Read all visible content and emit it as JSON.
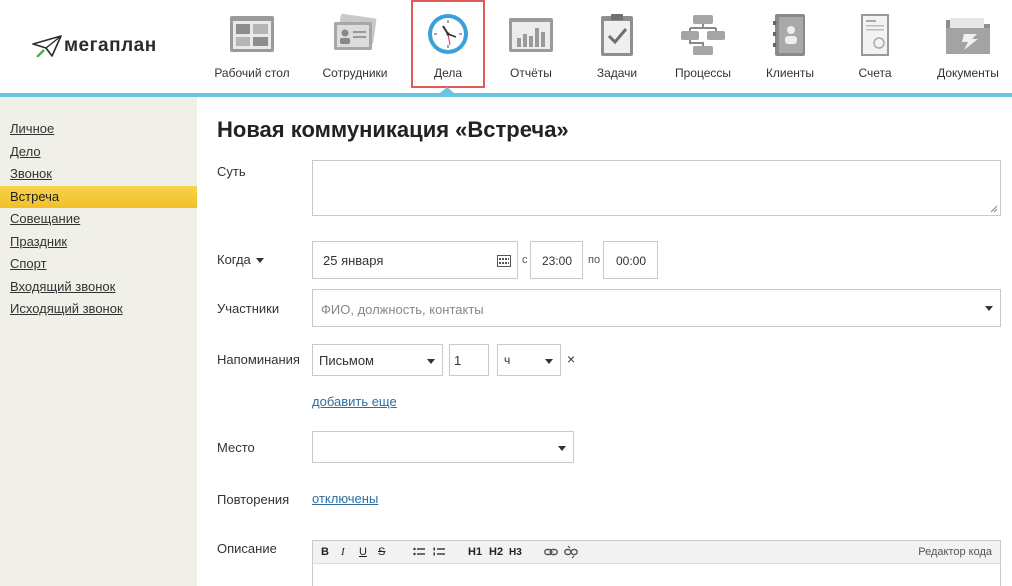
{
  "brand": {
    "logo_text": "мегаплан"
  },
  "nav": {
    "items": [
      {
        "label": "Рабочий стол",
        "icon": "desktop-icon"
      },
      {
        "label": "Сотрудники",
        "icon": "employees-icon"
      },
      {
        "label": "Дела",
        "icon": "clock-icon",
        "active": true
      },
      {
        "label": "Отчёты",
        "icon": "reports-chart-icon"
      },
      {
        "label": "Задачи",
        "icon": "tasks-clipboard-icon"
      },
      {
        "label": "Процессы",
        "icon": "processes-flow-icon"
      },
      {
        "label": "Клиенты",
        "icon": "clients-addressbook-icon"
      },
      {
        "label": "Счета",
        "icon": "invoice-icon"
      },
      {
        "label": "Документы",
        "icon": "documents-folder-icon"
      }
    ]
  },
  "sidebar": {
    "items": [
      {
        "label": "Личное"
      },
      {
        "label": "Дело"
      },
      {
        "label": "Звонок"
      },
      {
        "label": "Встреча",
        "active": true
      },
      {
        "label": "Совещание"
      },
      {
        "label": "Праздник"
      },
      {
        "label": "Спорт"
      },
      {
        "label": "Входящий звонок"
      },
      {
        "label": "Исходящий звонок"
      }
    ]
  },
  "form": {
    "title": "Новая коммуникация «Встреча»",
    "essence": {
      "label": "Суть",
      "value": ""
    },
    "when": {
      "label": "Когда",
      "date": "25 января",
      "from_label": "с",
      "from_time": "23:00",
      "to_label": "по",
      "to_time": "00:00"
    },
    "participants": {
      "label": "Участники",
      "placeholder": "ФИО, должность, контакты"
    },
    "reminders": {
      "label": "Напоминания",
      "method": "Письмом",
      "amount": "1",
      "unit": "ч",
      "remove": "×",
      "add_more": "добавить еще"
    },
    "place": {
      "label": "Место",
      "value": ""
    },
    "repeat": {
      "label": "Повторения",
      "value": "отключены"
    },
    "description": {
      "label": "Описание",
      "toolbar": {
        "bold": "B",
        "italic": "I",
        "underline": "U",
        "strike": "S",
        "h1": "H1",
        "h2": "H2",
        "h3": "H3",
        "code_editor": "Редактор кода"
      }
    }
  },
  "colors": {
    "accent_blue": "#6cc4e3",
    "active_yellow": "#f3c935",
    "sidebar_bg": "#f0efe8",
    "active_nav_border": "#e05a5a",
    "link": "#2f6e9e"
  }
}
